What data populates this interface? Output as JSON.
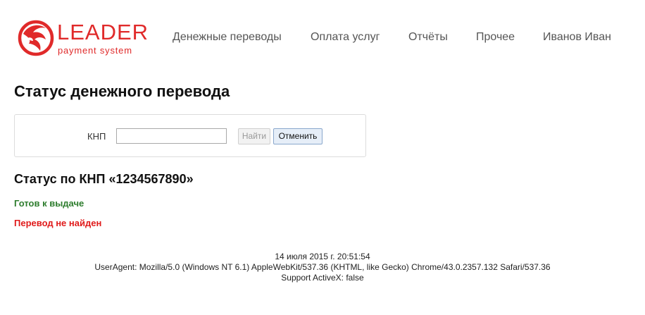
{
  "logo": {
    "word": "LEADER",
    "subtitle": "payment system",
    "icon": "lion-head-logo-icon",
    "color": "#e02a2a"
  },
  "nav": {
    "items": [
      {
        "label": "Денежные переводы"
      },
      {
        "label": "Оплата услуг"
      },
      {
        "label": "Отчёты"
      },
      {
        "label": "Прочее"
      },
      {
        "label": "Иванов Иван"
      }
    ]
  },
  "page": {
    "title": "Статус денежного перевода"
  },
  "form": {
    "label": "КНП",
    "input_value": "",
    "find_label": "Найти",
    "cancel_label": "Отменить"
  },
  "status": {
    "heading": "Статус по КНП «1234567890»",
    "ok_text": "Готов к выдаче",
    "ok_color": "#2e7d2e",
    "error_text": "Перевод не найден",
    "error_color": "#e01b1b"
  },
  "footer": {
    "datetime": "14 июля 2015 г. 20:51:54",
    "user_agent": "UserAgent: Mozilla/5.0 (Windows NT 6.1) AppleWebKit/537.36 (KHTML, like Gecko) Chrome/43.0.2357.132 Safari/537.36",
    "activex": "Support ActiveX: false"
  }
}
